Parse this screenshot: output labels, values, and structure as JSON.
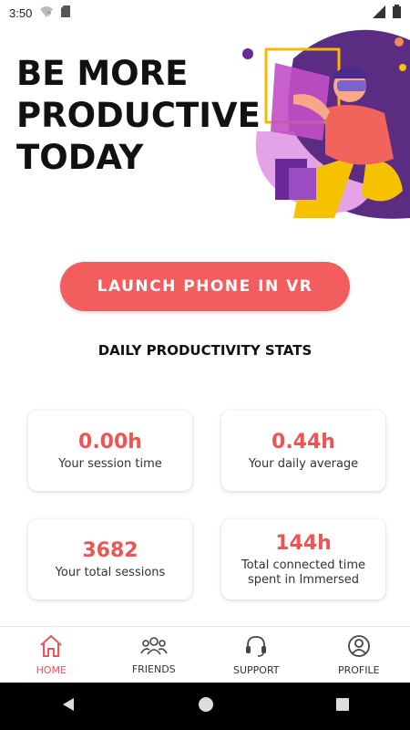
{
  "status_bar": {
    "time": "3:50"
  },
  "hero": {
    "line1": "BE MORE",
    "line2": "PRODUCTIVE",
    "line3": "TODAY"
  },
  "launch_button": {
    "label": "LAUNCH PHONE IN VR"
  },
  "stats": {
    "heading": "DAILY PRODUCTIVITY STATS",
    "cards": [
      {
        "value": "0.00h",
        "label": "Your session time"
      },
      {
        "value": "0.44h",
        "label": "Your daily average"
      },
      {
        "value": "3682",
        "label": "Your total sessions"
      },
      {
        "value": "144h",
        "label": "Total connected time spent in Immersed"
      }
    ]
  },
  "bottom_nav": {
    "items": [
      {
        "label": "HOME",
        "icon": "home-icon",
        "active": true
      },
      {
        "label": "FRIENDS",
        "icon": "friends-icon",
        "active": false
      },
      {
        "label": "SUPPORT",
        "icon": "headset-icon",
        "active": false
      },
      {
        "label": "PROFILE",
        "icon": "profile-icon",
        "active": false
      }
    ]
  },
  "colors": {
    "accent": "#f25d5d",
    "stat_value": "#ef5353"
  }
}
